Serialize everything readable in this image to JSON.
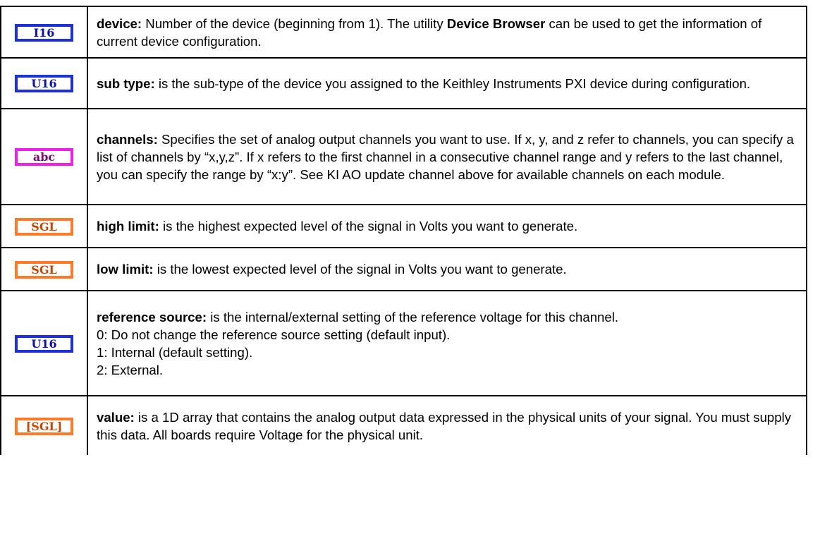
{
  "rows": [
    {
      "type_label": "I16",
      "term": "device:",
      "text": " Number of the device (beginning from 1). The utility ",
      "bold_phrase": "Device Browser",
      "text_after": " can be used to get the information of current device configuration."
    },
    {
      "type_label": "U16",
      "term": "sub type:",
      "text": " is the sub-type of the device you assigned to the Keithley Instruments PXI device during configuration."
    },
    {
      "type_label": "abc",
      "term": "channels:",
      "text": " Specifies the set of analog output channels you want to use. If x, y, and z refer to channels, you can specify a list of channels by “x,y,z”. If x refers to the first channel in a consecutive channel range and y refers to the last channel, you can specify the range by “x:y”. See KI AO update channel above for available channels on each module."
    },
    {
      "type_label": "SGL",
      "term": "high limit:",
      "text": " is the highest expected level of the signal in Volts you want to generate."
    },
    {
      "type_label": "SGL",
      "term": "low limit:",
      "text": " is the lowest expected level of the signal in Volts you want to generate."
    },
    {
      "type_label": "U16",
      "term": "reference source:",
      "text": " is the internal/external setting of the reference voltage for this channel.",
      "lines": [
        "0: Do not change the reference source setting (default input).",
        "1: Internal (default setting).",
        "2: External."
      ]
    },
    {
      "type_label": "[SGL]",
      "term": "value:",
      "text": " is a 1D array that contains the analog output data expressed in the physical units of your signal. You must supply this data. All boards require Voltage for the physical unit."
    }
  ],
  "colors": {
    "int_terminal": "#1c2fd9",
    "string_terminal": "#f01ee6",
    "single_terminal": "#ff7a28"
  },
  "icons": [
    "i16-terminal-icon",
    "u16-terminal-icon",
    "string-terminal-icon",
    "sgl-terminal-icon",
    "sgl-array-terminal-icon"
  ]
}
